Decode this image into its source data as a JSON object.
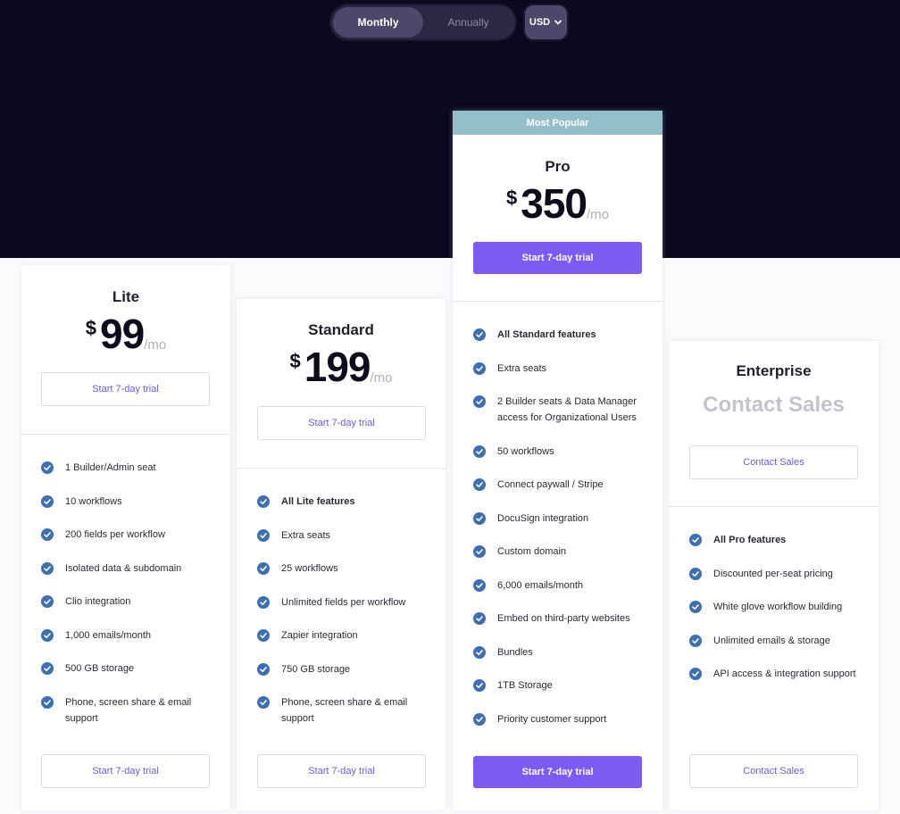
{
  "billing_toggle": {
    "monthly": "Monthly",
    "annually": "Annually",
    "selected": "Monthly"
  },
  "currency": {
    "label": "USD"
  },
  "colors": {
    "hero_bg": "#0b0920",
    "accent": "#7d5af2",
    "check": "#3f6fb0",
    "popular_banner": "#93bfca"
  },
  "plans": [
    {
      "name": "Lite",
      "currency_symbol": "$",
      "price": "99",
      "period": "/mo",
      "cta_top": "Start 7-day trial",
      "cta_bottom": "Start 7-day trial",
      "features": [
        "1 Builder/Admin seat",
        "10 workflows",
        "200 fields per workflow",
        "Isolated data & subdomain",
        "Clio integration",
        "1,000 emails/month",
        "500 GB storage",
        "Phone, screen share & email support"
      ]
    },
    {
      "name": "Standard",
      "currency_symbol": "$",
      "price": "199",
      "period": "/mo",
      "cta_top": "Start 7-day trial",
      "cta_bottom": "Start 7-day trial",
      "features": [
        "All Lite features",
        "Extra seats",
        "25 workflows",
        "Unlimited fields per workflow",
        "Zapier integration",
        "750 GB storage",
        "Phone, screen share & email support"
      ]
    },
    {
      "badge": "Most Popular",
      "name": "Pro",
      "currency_symbol": "$",
      "price": "350",
      "period": "/mo",
      "cta_top": "Start 7-day trial",
      "cta_bottom": "Start 7-day trial",
      "features": [
        "All Standard features",
        "Extra seats",
        "2 Builder seats & Data Manager access for Organizational Users",
        "50 workflows",
        "Connect paywall / Stripe",
        "DocuSign integration",
        "Custom domain",
        "6,000 emails/month",
        "Embed on third-party websites",
        "Bundles",
        "1TB Storage",
        "Priority customer support"
      ]
    },
    {
      "name": "Enterprise",
      "price_text": "Contact Sales",
      "cta_top": "Contact Sales",
      "cta_bottom": "Contact Sales",
      "features": [
        "All Pro features",
        "Discounted per-seat pricing",
        "White glove workflow building",
        "Unlimited emails & storage",
        "API access & integration support"
      ]
    }
  ]
}
